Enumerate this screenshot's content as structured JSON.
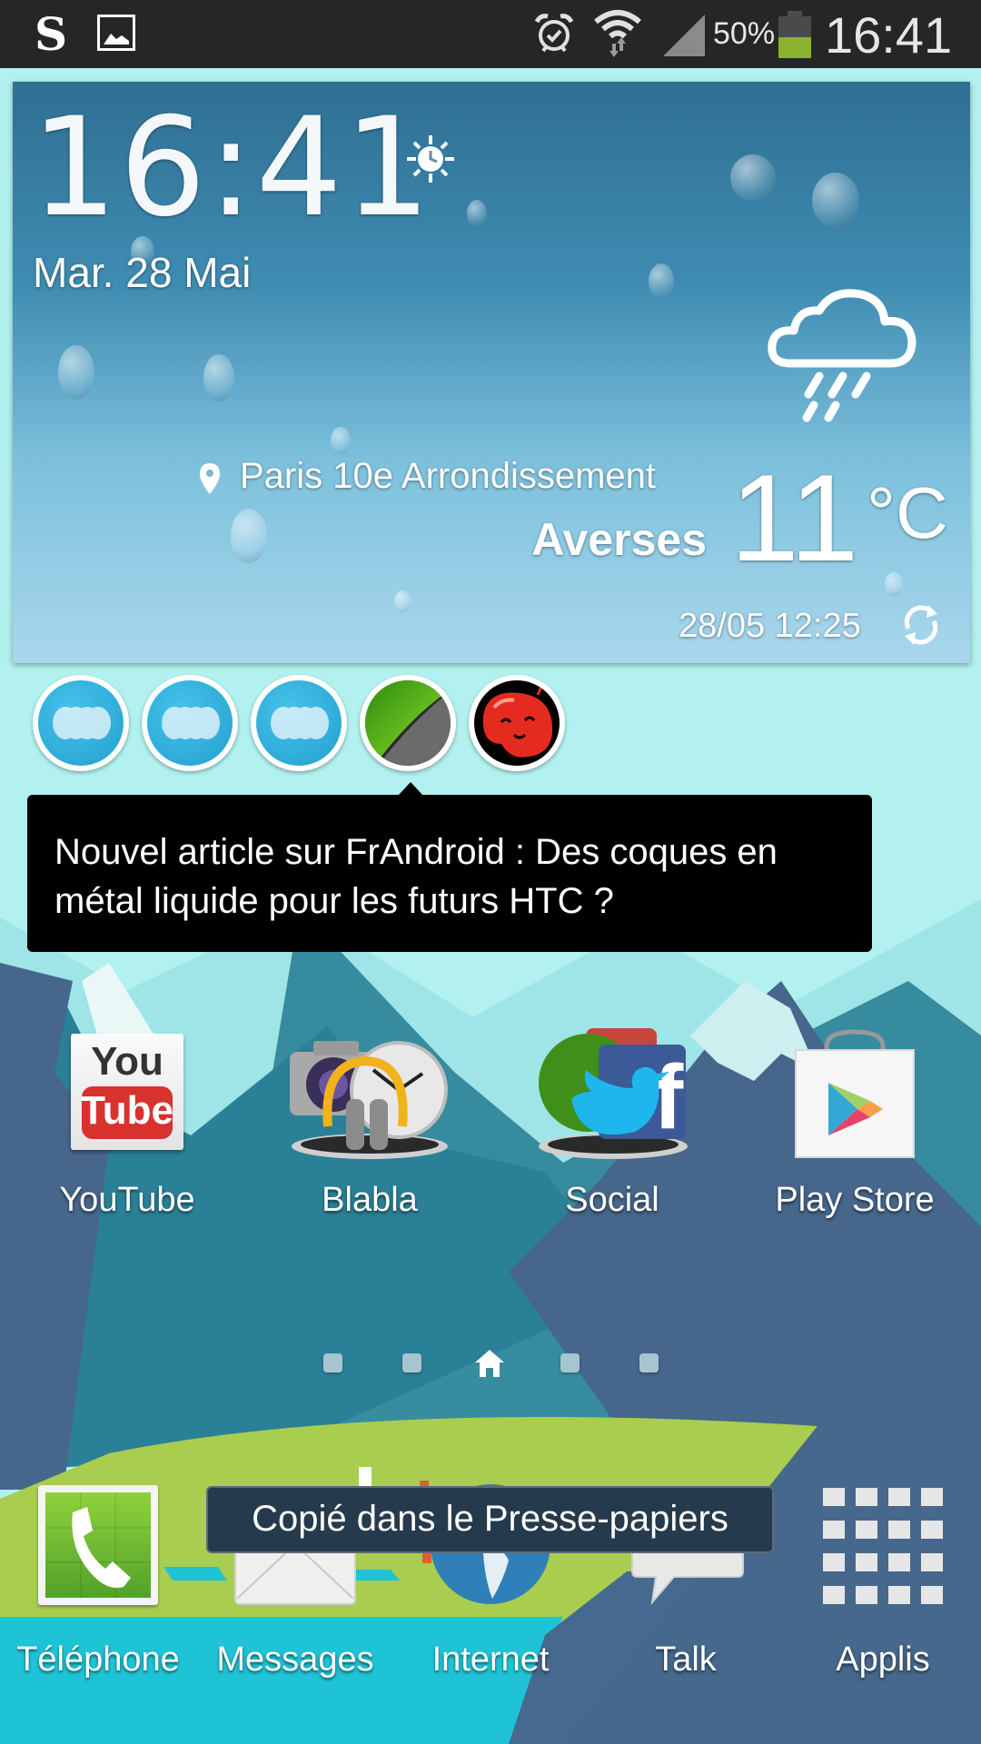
{
  "status_bar": {
    "left_icons": [
      "swype-s-icon",
      "gallery-image-icon"
    ],
    "right_icons": [
      "alarm-icon",
      "wifi-icon",
      "signal-icon",
      "battery-icon"
    ],
    "battery_percent_label": "50%",
    "battery_level": 0.5,
    "time": "16:41",
    "colors": {
      "background": "#262626",
      "battery_fill": "#8ab22f"
    }
  },
  "weather_widget": {
    "time": "16:41",
    "date": "Mar. 28 Mai",
    "alarm_icon": "sun-clock-icon",
    "location": "Paris 10e  Arrondissement",
    "condition": "Averses",
    "temperature": "11",
    "temperature_unit": "°C",
    "updated": "28/05 12:25",
    "weather_icon": "cloud-rain-icon",
    "refresh_icon": "refresh-icon"
  },
  "notification_bubbles": [
    {
      "name": "bubble-app-1",
      "icon": "blue-dots-icon"
    },
    {
      "name": "bubble-app-2",
      "icon": "blue-dots-icon"
    },
    {
      "name": "bubble-app-3",
      "icon": "blue-dots-icon"
    },
    {
      "name": "bubble-frandroid",
      "icon": "green-sphere-icon"
    },
    {
      "name": "bubble-jellybean",
      "icon": "red-jellybean-icon"
    }
  ],
  "notification_popup": {
    "text": "Nouvel article sur FrAndroid : Des coques en métal liquide pour les futurs HTC ?"
  },
  "home_apps": [
    {
      "label": "YouTube",
      "icon": "youtube-icon",
      "icon_top": "You",
      "icon_bottom": "Tube"
    },
    {
      "label": "Blabla",
      "icon": "folder-media-icon"
    },
    {
      "label": "Social",
      "icon": "folder-social-icon",
      "icon_letter": "f"
    },
    {
      "label": "Play Store",
      "icon": "play-store-icon"
    }
  ],
  "page_indicator": {
    "pages": 5,
    "current": 3,
    "home_icon": "home-icon"
  },
  "dock": [
    {
      "label": "Téléphone",
      "icon": "phone-icon"
    },
    {
      "label": "Messages",
      "icon": "messages-icon"
    },
    {
      "label": "Internet",
      "icon": "globe-icon"
    },
    {
      "label": "Talk",
      "icon": "talk-bubble-icon"
    },
    {
      "label": "Applis",
      "icon": "apps-grid-icon"
    }
  ],
  "toast": {
    "text": "Copié dans le Presse-papiers"
  }
}
